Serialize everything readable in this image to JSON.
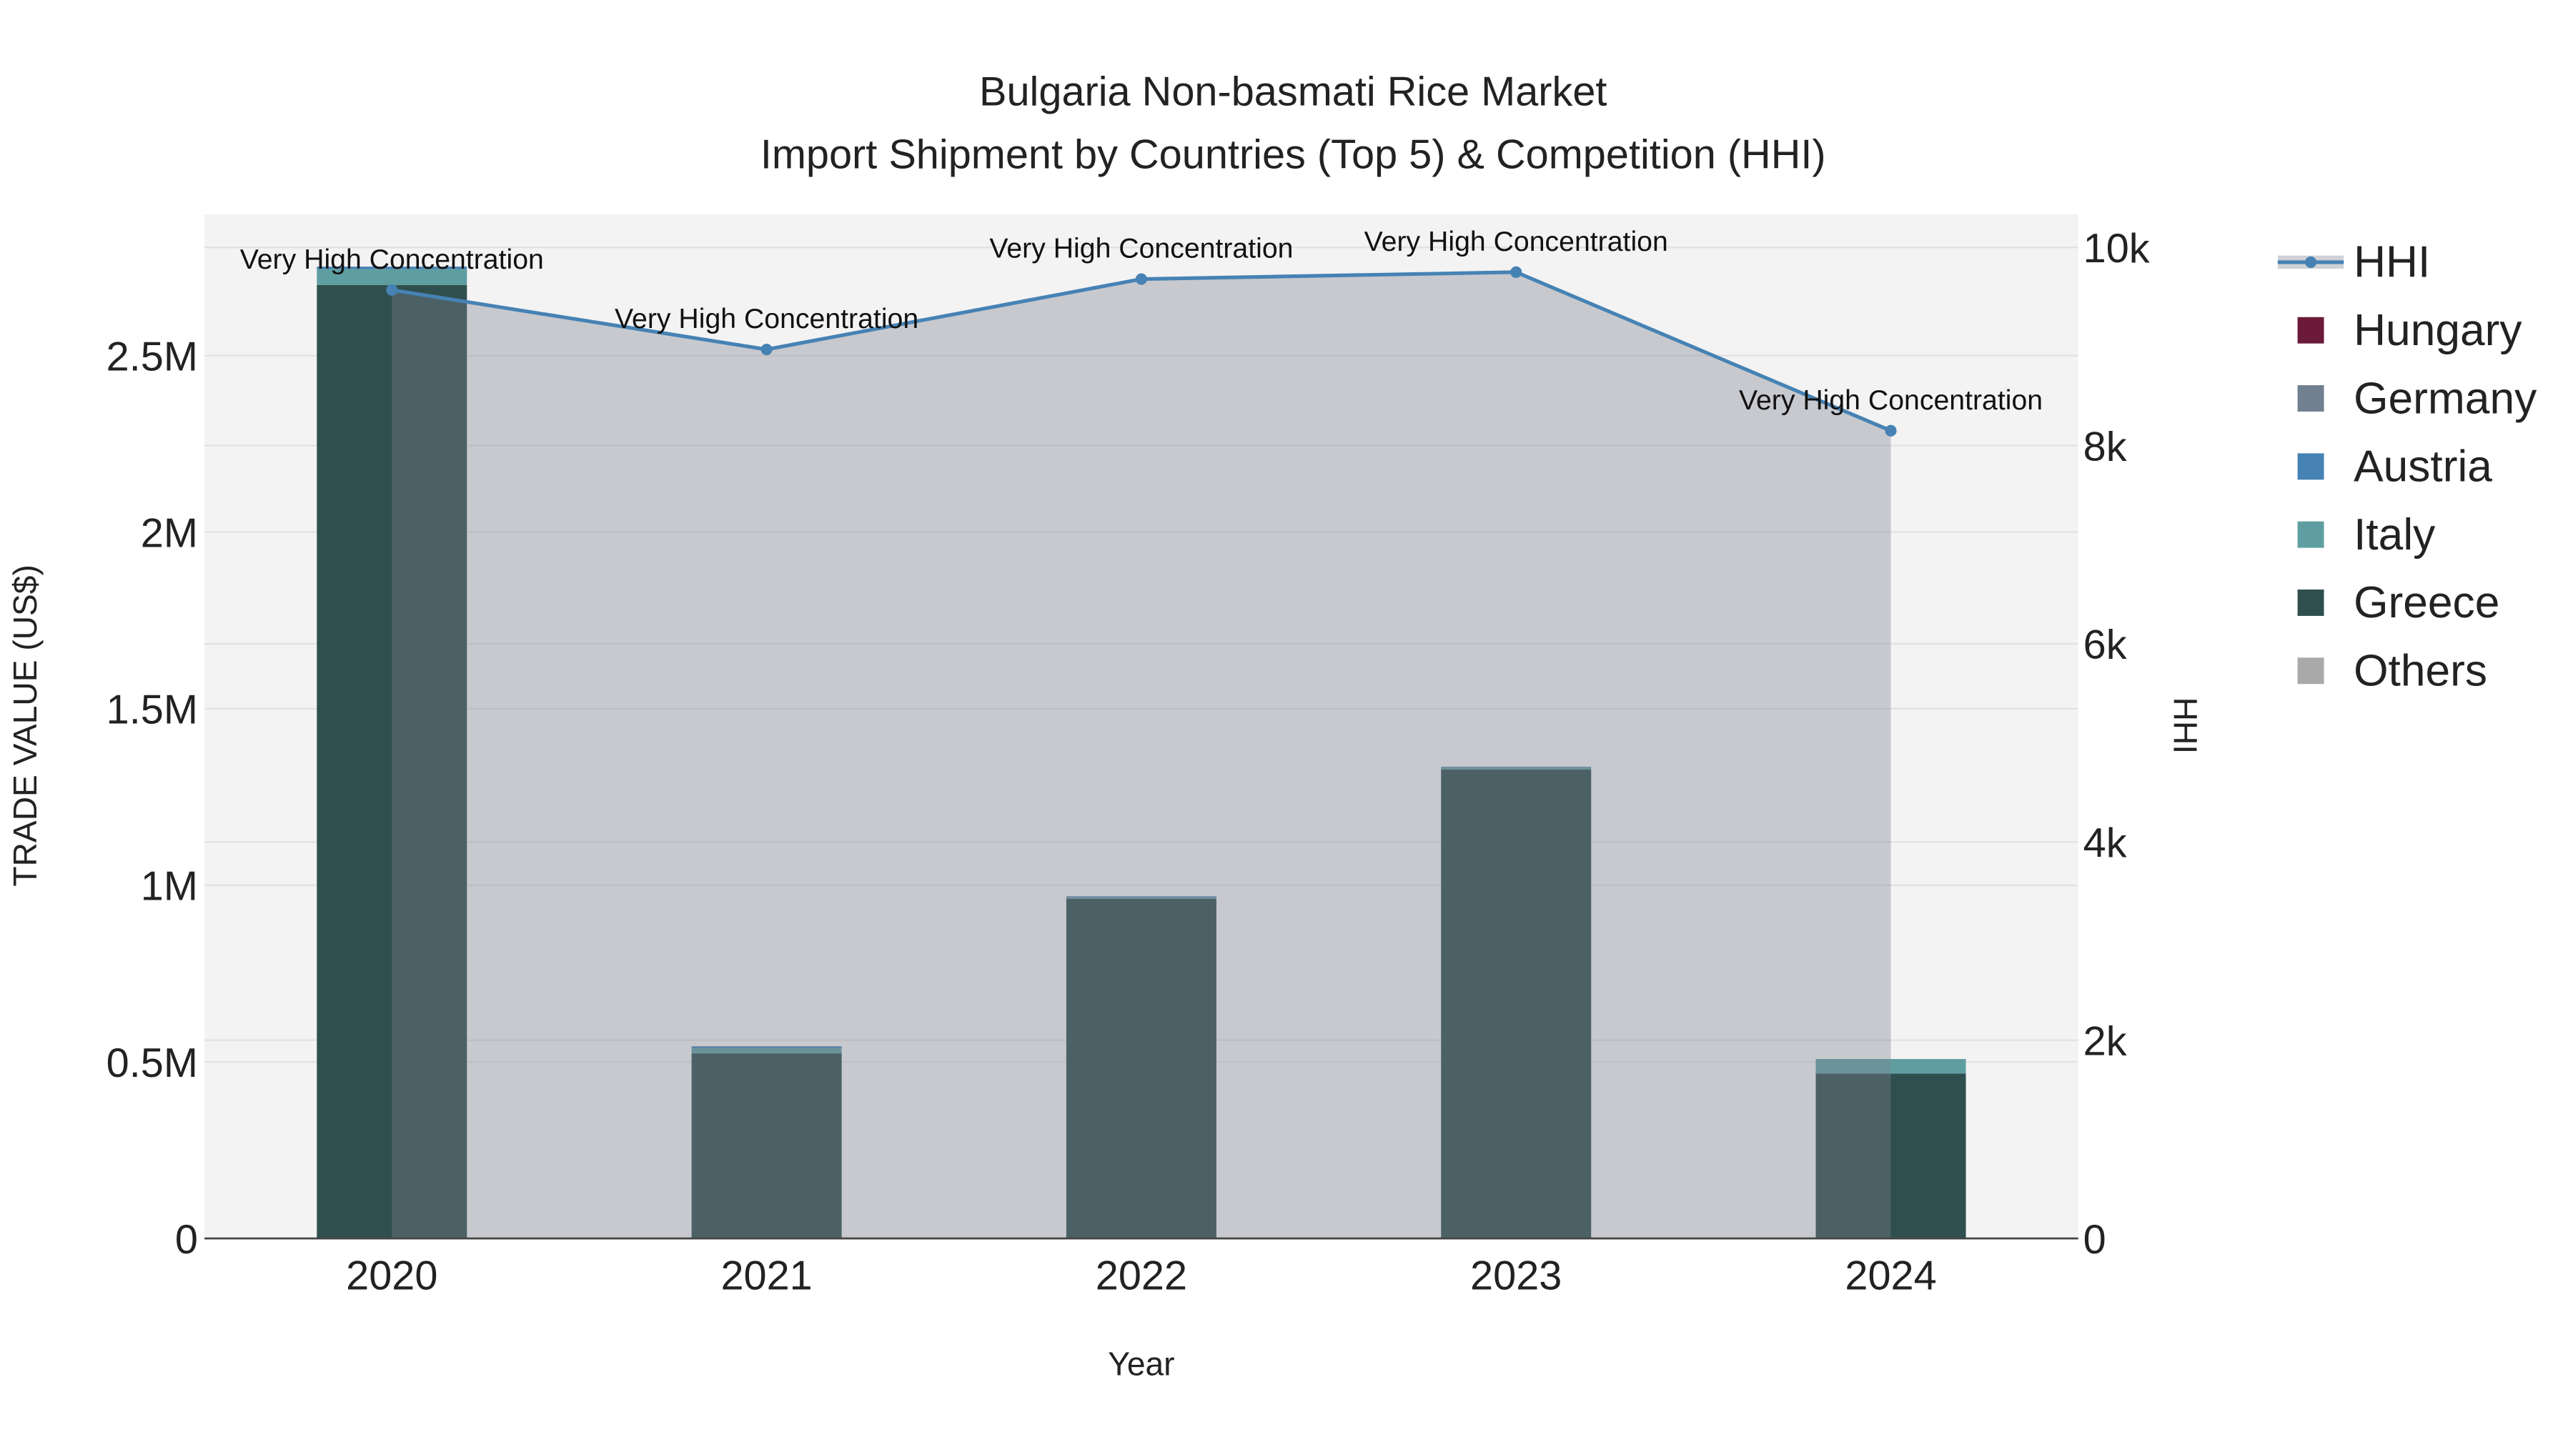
{
  "chart_data": {
    "type": "bar",
    "title_line1": "Bulgaria Non-basmati Rice Market",
    "title_line2": "Import Shipment by Countries (Top 5) & Competition (HHI)",
    "xlabel": "Year",
    "ylabel": "TRADE VALUE (US$)",
    "y2label": "HHI",
    "categories": [
      "2020",
      "2021",
      "2022",
      "2023",
      "2024"
    ],
    "ylim": [
      0,
      2900000
    ],
    "y2lim": [
      0,
      10333
    ],
    "yticks": [
      {
        "v": 0,
        "t": "0"
      },
      {
        "v": 500000,
        "t": "0.5M"
      },
      {
        "v": 1000000,
        "t": "1M"
      },
      {
        "v": 1500000,
        "t": "1.5M"
      },
      {
        "v": 2000000,
        "t": "2M"
      },
      {
        "v": 2500000,
        "t": "2.5M"
      }
    ],
    "y2ticks": [
      {
        "v": 0,
        "t": "0"
      },
      {
        "v": 2000,
        "t": "2k"
      },
      {
        "v": 4000,
        "t": "4k"
      },
      {
        "v": 6000,
        "t": "6k"
      },
      {
        "v": 8000,
        "t": "8k"
      },
      {
        "v": 10000,
        "t": "10k"
      }
    ],
    "series": [
      {
        "name": "Greece",
        "color": "#2f4f4f",
        "values": [
          2700000,
          524000,
          962000,
          1328000,
          467000
        ]
      },
      {
        "name": "Italy",
        "color": "#5f9ea0",
        "values": [
          45000,
          14000,
          2000,
          6000,
          41000
        ]
      },
      {
        "name": "Austria",
        "color": "#4682b4",
        "values": [
          7000,
          6000,
          3000,
          1000,
          0
        ]
      },
      {
        "name": "Germany",
        "color": "#708090",
        "values": [
          0,
          0,
          2000,
          1000,
          0
        ]
      },
      {
        "name": "Hungary",
        "color": "#6b1a3a",
        "values": [
          0,
          0,
          0,
          0,
          0
        ]
      },
      {
        "name": "Others",
        "color": "#a9a9a9",
        "values": [
          0,
          0,
          0,
          0,
          0
        ]
      }
    ],
    "hhi": {
      "name": "HHI",
      "color": "#4682b4",
      "values": [
        9570,
        8970,
        9680,
        9750,
        8150
      ],
      "annotations": [
        "Very High Concentration",
        "Very High Concentration",
        "Very High Concentration",
        "Very High Concentration",
        "Very High Concentration"
      ]
    },
    "legend": [
      "HHI",
      "Hungary",
      "Germany",
      "Austria",
      "Italy",
      "Greece",
      "Others"
    ],
    "legend_placement": "right",
    "grid": true
  }
}
